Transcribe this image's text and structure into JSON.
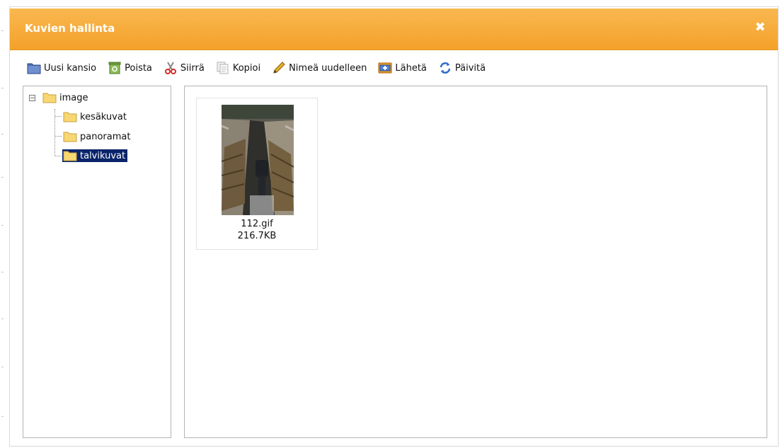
{
  "window": {
    "title": "Kuvien hallinta"
  },
  "toolbar": {
    "buttons": [
      {
        "label": "Uusi kansio",
        "icon": "new-folder-icon"
      },
      {
        "label": "Poista",
        "icon": "trash-icon"
      },
      {
        "label": "Siirrä",
        "icon": "scissors-icon"
      },
      {
        "label": "Kopioi",
        "icon": "copy-icon"
      },
      {
        "label": "Nimeä uudelleen",
        "icon": "pencil-icon"
      },
      {
        "label": "Lähetä",
        "icon": "upload-icon"
      },
      {
        "label": "Päivitä",
        "icon": "refresh-icon"
      }
    ]
  },
  "tree": {
    "root": {
      "label": "image",
      "toggle": "−",
      "expanded": true
    },
    "children": [
      {
        "label": "kesäkuvat",
        "selected": false
      },
      {
        "label": "panoramat",
        "selected": false
      },
      {
        "label": "talvikuvat",
        "selected": true
      }
    ]
  },
  "files": [
    {
      "name": "112.gif",
      "size": "216.7KB"
    }
  ],
  "colors": {
    "titlebar": "#f4a12a",
    "selection": "#0a246a",
    "folder": "#f7d774"
  }
}
